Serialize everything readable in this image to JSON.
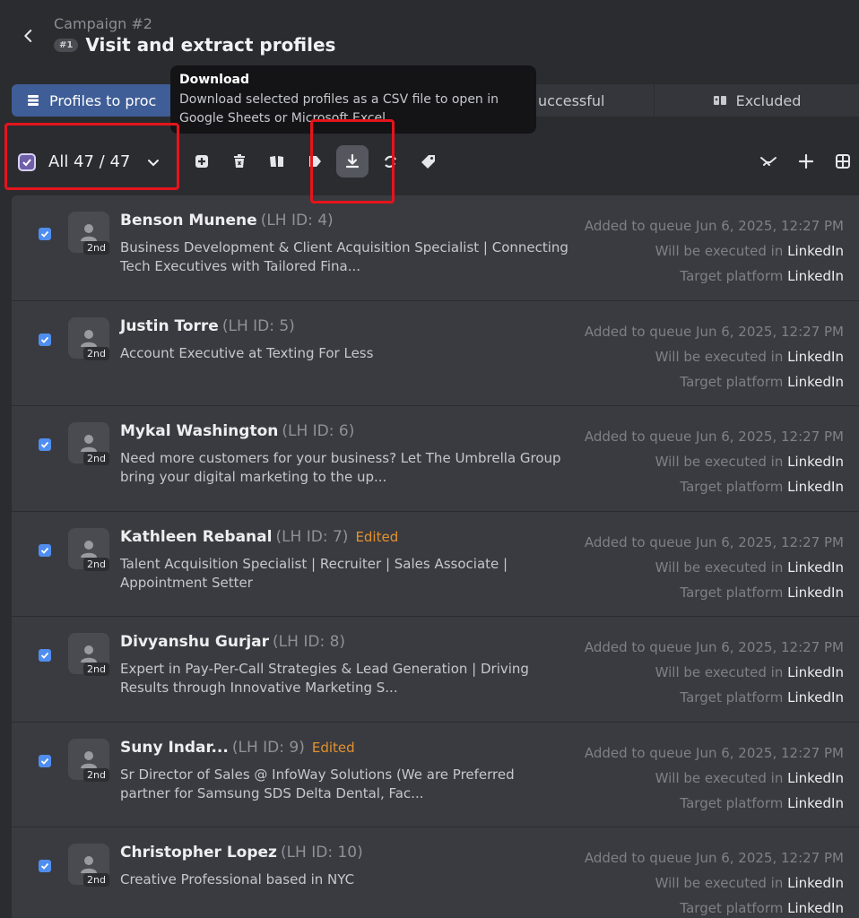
{
  "header": {
    "campaign": "Campaign #2",
    "badge": "#1",
    "title": "Visit and extract profiles"
  },
  "tabs": {
    "profiles": "Profiles to proc",
    "successful": "uccessful",
    "excluded": "Excluded"
  },
  "tooltip": {
    "title": "Download",
    "description": "Download selected profiles as a CSV file to open in Google Sheets or Microsoft Excel"
  },
  "toolbar": {
    "select_all_label": "All 47 / 47"
  },
  "colors": {
    "accent_tab": "#3f5d96",
    "checkbox": "#4f8ef0",
    "edited": "#e3922f",
    "highlight_box": "#e5141b"
  },
  "profiles": [
    {
      "name": "Benson Munene",
      "lh_id": "(LH ID: 4)",
      "edited": "",
      "degree": "2nd",
      "headline": "Business Development & Client Acquisition Specialist | Connecting Tech Executives with Tailored Fina...",
      "added": "Added to queue Jun 6, 2025, 12:27 PM",
      "executed_label": "Will be executed in",
      "executed_value": "LinkedIn",
      "target_label": "Target platform",
      "target_value": "LinkedIn"
    },
    {
      "name": "Justin Torre",
      "lh_id": "(LH ID: 5)",
      "edited": "",
      "degree": "2nd",
      "headline": "Account Executive at Texting For Less",
      "added": "Added to queue Jun 6, 2025, 12:27 PM",
      "executed_label": "Will be executed in",
      "executed_value": "LinkedIn",
      "target_label": "Target platform",
      "target_value": "LinkedIn"
    },
    {
      "name": "Mykal Washington",
      "lh_id": "(LH ID: 6)",
      "edited": "",
      "degree": "2nd",
      "headline": "Need more customers for your business? Let The Umbrella Group bring your digital marketing to the up...",
      "added": "Added to queue Jun 6, 2025, 12:27 PM",
      "executed_label": "Will be executed in",
      "executed_value": "LinkedIn",
      "target_label": "Target platform",
      "target_value": "LinkedIn"
    },
    {
      "name": "Kathleen Rebanal",
      "lh_id": "(LH ID: 7)",
      "edited": "Edited",
      "degree": "2nd",
      "headline": "Talent Acquisition Specialist | Recruiter | Sales Associate | Appointment Setter",
      "added": "Added to queue Jun 6, 2025, 12:27 PM",
      "executed_label": "Will be executed in",
      "executed_value": "LinkedIn",
      "target_label": "Target platform",
      "target_value": "LinkedIn"
    },
    {
      "name": "Divyanshu Gurjar",
      "lh_id": "(LH ID: 8)",
      "edited": "",
      "degree": "2nd",
      "headline": "Expert in Pay-Per-Call Strategies & Lead Generation | Driving Results through Innovative Marketing S...",
      "added": "Added to queue Jun 6, 2025, 12:27 PM",
      "executed_label": "Will be executed in",
      "executed_value": "LinkedIn",
      "target_label": "Target platform",
      "target_value": "LinkedIn"
    },
    {
      "name": "Suny Indar...",
      "lh_id": "(LH ID: 9)",
      "edited": "Edited",
      "degree": "2nd",
      "headline": "Sr Director of Sales @ InfoWay Solutions (We are Preferred partner for Samsung SDS Delta Dental, Fac...",
      "added": "Added to queue Jun 6, 2025, 12:27 PM",
      "executed_label": "Will be executed in",
      "executed_value": "LinkedIn",
      "target_label": "Target platform",
      "target_value": "LinkedIn"
    },
    {
      "name": "Christopher Lopez",
      "lh_id": "(LH ID: 10)",
      "edited": "",
      "degree": "2nd",
      "headline": "Creative Professional based in NYC",
      "added": "Added to queue Jun 6, 2025, 12:27 PM",
      "executed_label": "Will be executed in",
      "executed_value": "LinkedIn",
      "target_label": "Target platform",
      "target_value": "LinkedIn"
    }
  ]
}
